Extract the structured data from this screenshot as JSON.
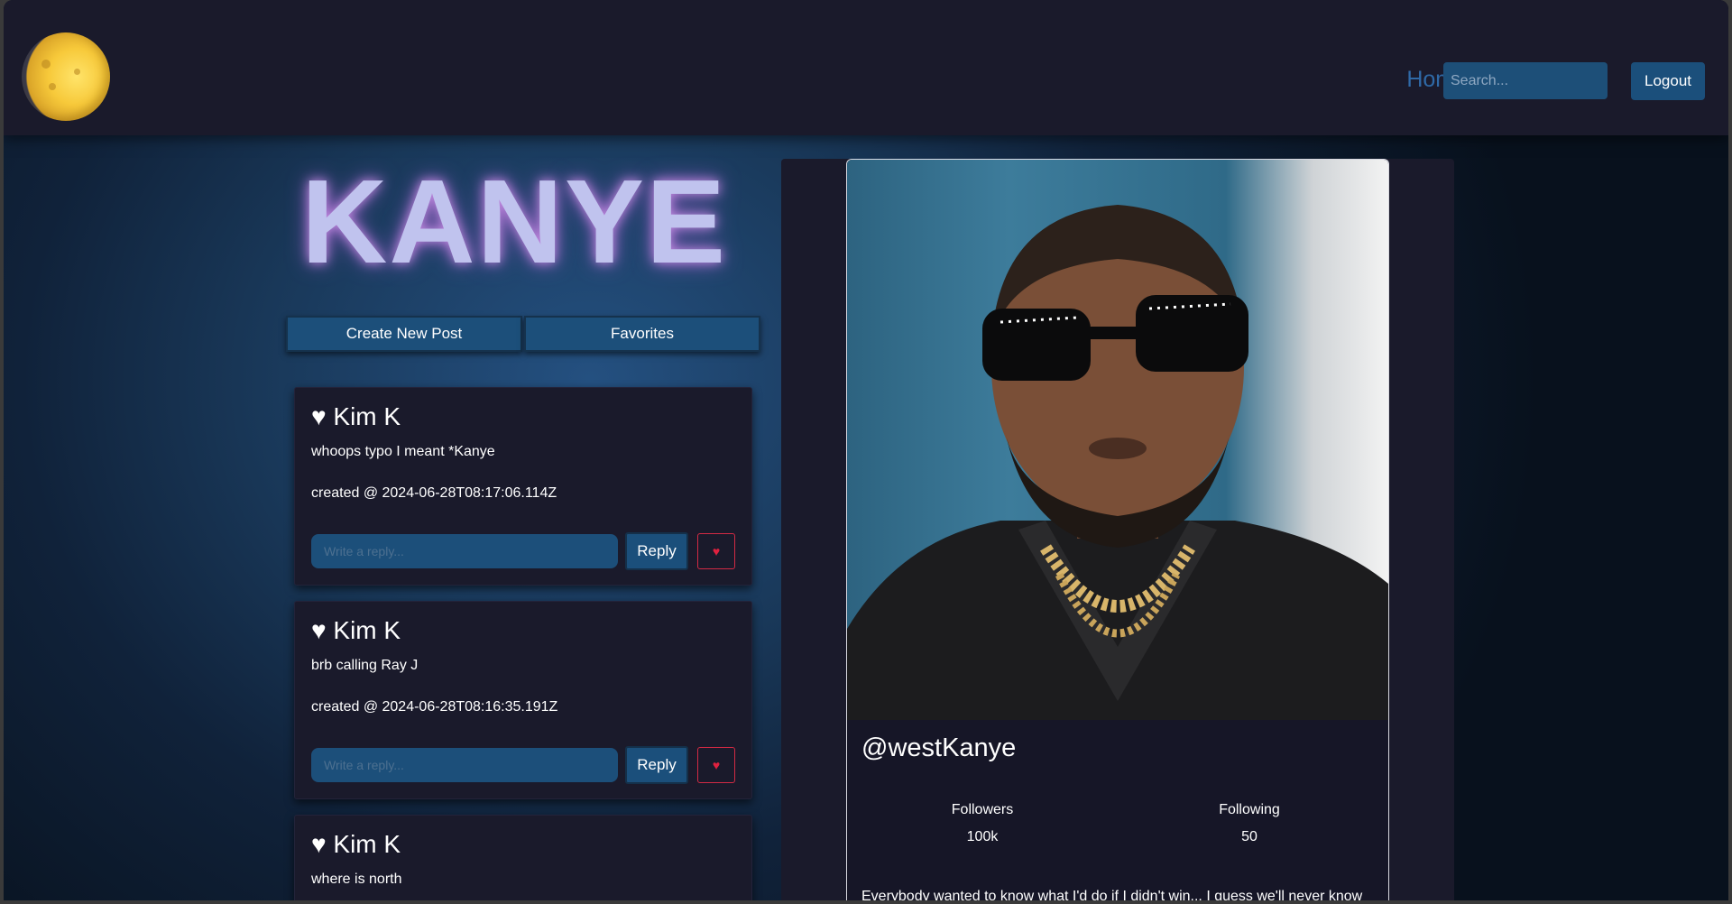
{
  "nav": {
    "home_label": "Home",
    "search_placeholder": "Search...",
    "logout_label": "Logout"
  },
  "page": {
    "title": "KANYE",
    "create_post_label": "Create New Post",
    "favorites_label": "Favorites"
  },
  "posts": [
    {
      "author": "♥ Kim K",
      "body": "whoops typo I meant *Kanye",
      "date": "created @ 2024-06-28T08:17:06.114Z",
      "reply_placeholder": "Write a reply...",
      "reply_label": "Reply",
      "heart": "♥"
    },
    {
      "author": "♥ Kim K",
      "body": "brb calling Ray J",
      "date": "created @ 2024-06-28T08:16:35.191Z",
      "reply_placeholder": "Write a reply...",
      "reply_label": "Reply",
      "heart": "♥"
    },
    {
      "author": "♥ Kim K",
      "body": "where is north"
    }
  ],
  "profile": {
    "handle": "@westKanye",
    "followers_label": "Followers",
    "followers_value": "100k",
    "following_label": "Following",
    "following_value": "50",
    "bio": "Everybody wanted to know what I'd do if I didn't win... I guess we'll never know"
  },
  "colors": {
    "navbar_bg": "#1a1a2b",
    "accent_blue": "#1c4f7a",
    "title_glow": "#c28be0",
    "heart_red": "#e0213f"
  }
}
